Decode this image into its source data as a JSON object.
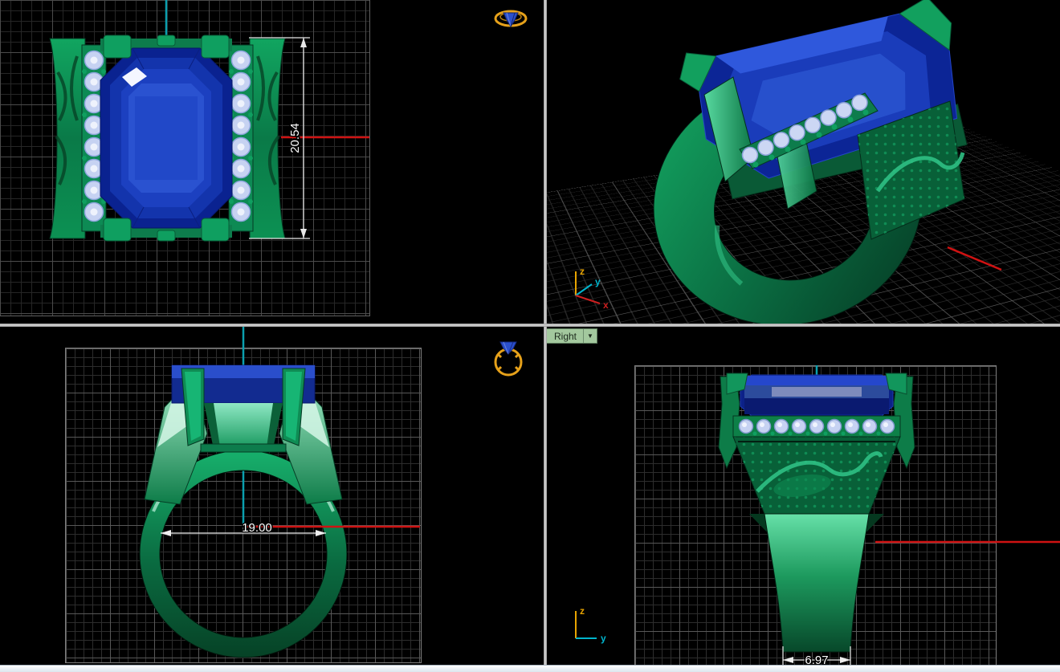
{
  "viewports": {
    "top": {
      "dimension_label": "20.54"
    },
    "perspective": {
      "axis": {
        "x": "x",
        "y": "y",
        "z": "z"
      }
    },
    "front": {
      "dimension_label": "19.00"
    },
    "right": {
      "tab_label": "Right",
      "tab_dropdown_glyph": "▼",
      "dimension_label": "6.97",
      "axis": {
        "y": "y",
        "z": "z"
      }
    }
  },
  "icons": {
    "ring_perspective_icon": "gold-ring-with-blue-gem-tilted",
    "ring_front_icon": "gold-ring-with-blue-gem-front"
  },
  "colors": {
    "metal_green": "#0d8a52",
    "stone_blue": "#1a3cba",
    "melee_diamond": "#c6d2f2",
    "axis_red": "#cf1212",
    "axis_teal": "#0b9fae",
    "gizmo_z_orange": "#e8a400",
    "dimension_white": "#ffffff",
    "right_tab_bg": "#a3c89e"
  }
}
